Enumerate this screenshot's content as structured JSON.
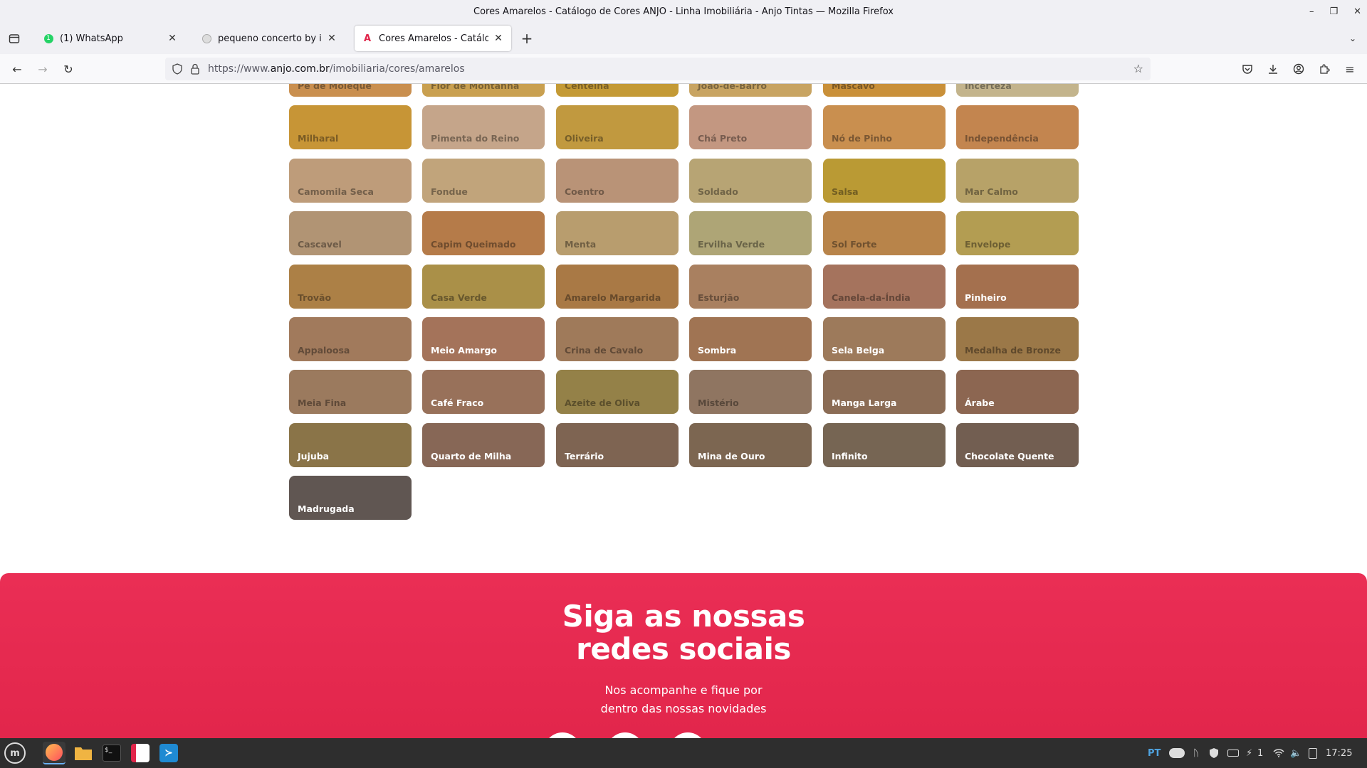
{
  "window": {
    "title": "Cores Amarelos - Catálogo de Cores ANJO - Linha Imobiliária - Anjo Tintas — Mozilla Firefox"
  },
  "tabs": [
    {
      "label": "(1) WhatsApp",
      "icon": "whatsapp-icon",
      "active": false
    },
    {
      "label": "pequeno concerto by igorb",
      "icon": "github-icon",
      "active": false
    },
    {
      "label": "Cores Amarelos - Catálogo d",
      "icon": "anjo-icon",
      "active": true
    }
  ],
  "url": {
    "prefix": "https://www.",
    "host": "anjo.com.br",
    "path": "/imobiliaria/cores/amarelos"
  },
  "colors": [
    {
      "name": "Pé de Moleque",
      "bg": "#c98f4f",
      "fg": "#7a5a35"
    },
    {
      "name": "Flor de Montanha",
      "bg": "#c9a050",
      "fg": "#7a6234"
    },
    {
      "name": "Centelha",
      "bg": "#c49a35",
      "fg": "#7a5f25"
    },
    {
      "name": "João-de-Barro",
      "bg": "#c8a462",
      "fg": "#7a653f"
    },
    {
      "name": "Mascavo",
      "bg": "#c99039",
      "fg": "#7a5826"
    },
    {
      "name": "Incerteza",
      "bg": "#c3b48c",
      "fg": "#766e57"
    },
    {
      "name": "Milharal",
      "bg": "#c79536",
      "fg": "#7a5b24"
    },
    {
      "name": "Pimenta do Reino",
      "bg": "#c5a58a",
      "fg": "#786553"
    },
    {
      "name": "Oliveira",
      "bg": "#c1993f",
      "fg": "#765e29"
    },
    {
      "name": "Chá Preto",
      "bg": "#c39781",
      "fg": "#775c4f"
    },
    {
      "name": "Nó de Pinho",
      "bg": "#c98f4f",
      "fg": "#7a5733"
    },
    {
      "name": "Independência",
      "bg": "#c3854f",
      "fg": "#775233"
    },
    {
      "name": "Camomila Seca",
      "bg": "#be9c7a",
      "fg": "#735f4a"
    },
    {
      "name": "Fondue",
      "bg": "#c1a47b",
      "fg": "#76644b"
    },
    {
      "name": "Coentro",
      "bg": "#b99377",
      "fg": "#715a48"
    },
    {
      "name": "Soldado",
      "bg": "#b7a474",
      "fg": "#706447"
    },
    {
      "name": "Salsa",
      "bg": "#ba9a34",
      "fg": "#725e22"
    },
    {
      "name": "Mar Calmo",
      "bg": "#b7a268",
      "fg": "#706341"
    },
    {
      "name": "Cascavel",
      "bg": "#b19474",
      "fg": "#6c5a47"
    },
    {
      "name": "Capim Queimado",
      "bg": "#b57b49",
      "fg": "#6f4c2e"
    },
    {
      "name": "Menta",
      "bg": "#b89d6e",
      "fg": "#705f43"
    },
    {
      "name": "Ervilha Verde",
      "bg": "#aea576",
      "fg": "#6a6448"
    },
    {
      "name": "Sol Forte",
      "bg": "#b8844a",
      "fg": "#70512f"
    },
    {
      "name": "Envelope",
      "bg": "#b39d52",
      "fg": "#6d5f33"
    },
    {
      "name": "Trovão",
      "bg": "#ac8046",
      "fg": "#694e2c"
    },
    {
      "name": "Casa Verde",
      "bg": "#aa9048",
      "fg": "#67572d"
    },
    {
      "name": "Amarelo Margarida",
      "bg": "#a97945",
      "fg": "#674a2b"
    },
    {
      "name": "Esturjão",
      "bg": "#a98060",
      "fg": "#674e3b"
    },
    {
      "name": "Canela-da-Índia",
      "bg": "#a5735d",
      "fg": "#654739"
    },
    {
      "name": "Pinheiro",
      "bg": "#a4704e",
      "fg": "#ffffff"
    },
    {
      "name": "Appaloosa",
      "bg": "#a17a5c",
      "fg": "#624b39"
    },
    {
      "name": "Meio Amargo",
      "bg": "#a4735a",
      "fg": "#ffffff"
    },
    {
      "name": "Crina de Cavalo",
      "bg": "#9f7a5a",
      "fg": "#614a37"
    },
    {
      "name": "Sombra",
      "bg": "#a07453",
      "fg": "#ffffff"
    },
    {
      "name": "Sela Belga",
      "bg": "#9d7a5b",
      "fg": "#ffffff"
    },
    {
      "name": "Medalha de Bronze",
      "bg": "#9b7848",
      "fg": "#5f492c"
    },
    {
      "name": "Meia Fina",
      "bg": "#9b7a5e",
      "fg": "#5f4a39"
    },
    {
      "name": "Café Fraco",
      "bg": "#98715a",
      "fg": "#ffffff"
    },
    {
      "name": "Azeite de Oliva",
      "bg": "#948148",
      "fg": "#5b4f2c"
    },
    {
      "name": "Mistério",
      "bg": "#8f7561",
      "fg": "#58483b"
    },
    {
      "name": "Manga Larga",
      "bg": "#8b6c55",
      "fg": "#ffffff"
    },
    {
      "name": "Árabe",
      "bg": "#8c6651",
      "fg": "#ffffff"
    },
    {
      "name": "Jujuba",
      "bg": "#8a7448",
      "fg": "#ffffff"
    },
    {
      "name": "Quarto de Milha",
      "bg": "#876756",
      "fg": "#ffffff"
    },
    {
      "name": "Terrário",
      "bg": "#7e6452",
      "fg": "#ffffff"
    },
    {
      "name": "Mina de Ouro",
      "bg": "#7c6651",
      "fg": "#ffffff"
    },
    {
      "name": "Infinito",
      "bg": "#766553",
      "fg": "#ffffff"
    },
    {
      "name": "Chocolate Quente",
      "bg": "#725e51",
      "fg": "#ffffff"
    },
    {
      "name": "Madrugada",
      "bg": "#605652",
      "fg": "#ffffff"
    }
  ],
  "footer": {
    "title_line1": "Siga as nossas",
    "title_line2": "redes sociais",
    "subtitle_line1": "Nos acompanhe e fique por",
    "subtitle_line2": "dentro das nossas novidades"
  },
  "taskbar": {
    "language": "PT",
    "notification_count": "1",
    "clock": "17:25"
  }
}
